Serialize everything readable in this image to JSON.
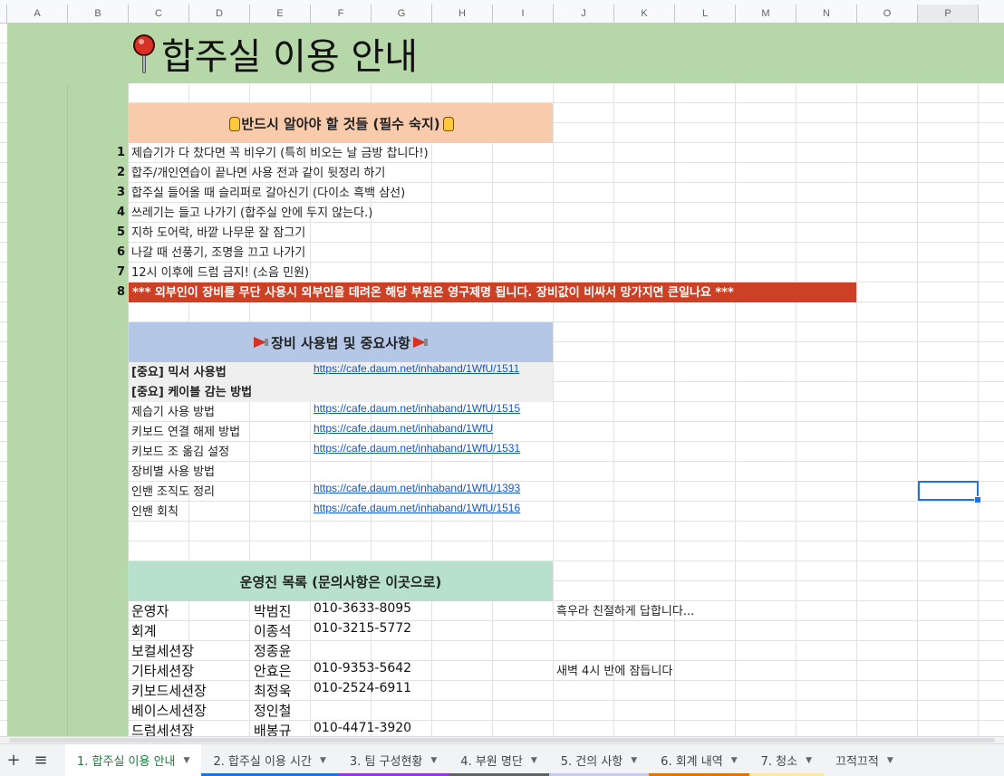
{
  "columns": [
    "A",
    "B",
    "C",
    "D",
    "E",
    "F",
    "G",
    "H",
    "I",
    "J",
    "K",
    "L",
    "M",
    "N",
    "O",
    "P"
  ],
  "selected_column": "P",
  "title": "합주실 이용 안내",
  "section1": {
    "header": "반드시 알아야 할 것들 (필수 숙지)"
  },
  "rules": [
    {
      "num": "1",
      "text": "제습기가 다 찼다면 꼭 비우기 (특히 비오는 날 금방 찹니다!)"
    },
    {
      "num": "2",
      "text": "합주/개인연습이 끝나면 사용 전과 같이 뒷정리 하기"
    },
    {
      "num": "3",
      "text": "합주실 들어올 때 슬리퍼로 갈아신기 (다이소 흑백 삼선)"
    },
    {
      "num": "4",
      "text": "쓰레기는 들고 나가기 (합주실 안에 두지 않는다.)"
    },
    {
      "num": "5",
      "text": "지하 도어락, 바깥 나무문 잘 잠그기"
    },
    {
      "num": "6",
      "text": "나갈 때 선풍기, 조명을 끄고 나가기"
    },
    {
      "num": "7",
      "text": "12시 이후에 드럼 금지! (소음 민원)"
    }
  ],
  "warning": {
    "num": "8",
    "text": "*** 외부인이 장비를 무단 사용시 외부인을 데려온 해당 부원은 영구제명 됩니다. 장비값이 비싸서 망가지면 큰일나요 ***"
  },
  "section2": {
    "header": "장비 사용법 및 중요사항"
  },
  "equipment": [
    {
      "label": "[중요] 믹서 사용법",
      "link": "https://cafe.daum.net/inhaband/1WfU/1511"
    },
    {
      "label": "[중요] 케이블 감는 방법",
      "link": ""
    },
    {
      "label": "제습기 사용 방법",
      "link": "https://cafe.daum.net/inhaband/1WfU/1515"
    },
    {
      "label": "키보드 연결 해제 방법",
      "link": "https://cafe.daum.net/inhaband/1WfU"
    },
    {
      "label": "키보드 조 옮김 설정",
      "link": "https://cafe.daum.net/inhaband/1WfU/1531"
    },
    {
      "label": "장비별 사용 방법",
      "link": ""
    },
    {
      "label": "인밴 조직도 정리",
      "link": "https://cafe.daum.net/inhaband/1WfU/1393"
    },
    {
      "label": "인밴 회칙",
      "link": "https://cafe.daum.net/inhaband/1WfU/1516"
    }
  ],
  "section3": {
    "header": "운영진 목록 (문의사항은 이곳으로)"
  },
  "staff": [
    {
      "role": "운영자",
      "name": "박범진",
      "phone": "010-3633-8095",
      "note": "흑우라 친절하게 답합니다..."
    },
    {
      "role": "회계",
      "name": "이종석",
      "phone": "010-3215-5772",
      "note": ""
    },
    {
      "role": "보컬세션장",
      "name": "정종윤",
      "phone": "",
      "note": ""
    },
    {
      "role": "기타세션장",
      "name": "안효은",
      "phone": "010-9353-5642",
      "note": "새벽 4시 반에 잠듭니다"
    },
    {
      "role": "키보드세션장",
      "name": "최정욱",
      "phone": "010-2524-6911",
      "note": ""
    },
    {
      "role": "베이스세션장",
      "name": "정인철",
      "phone": "",
      "note": ""
    },
    {
      "role": "드럼세션장",
      "name": "배봉규",
      "phone": "010-4471-3920",
      "note": ""
    }
  ],
  "sheet_tabs": [
    {
      "label": "1. 합주실 이용 안내",
      "active": true,
      "color": ""
    },
    {
      "label": "2. 합주실 이용 시간",
      "active": false,
      "color": "#1a73e8"
    },
    {
      "label": "3. 팀 구성현황",
      "active": false,
      "color": "#9334e6"
    },
    {
      "label": "4. 부원 명단",
      "active": false,
      "color": "#5f6368"
    },
    {
      "label": "5. 건의 사항",
      "active": false,
      "color": "#c5cae9"
    },
    {
      "label": "6. 회계 내역",
      "active": false,
      "color": "#e37400"
    },
    {
      "label": "7. 청소",
      "active": false,
      "color": "#fbe9a0"
    },
    {
      "label": "끄적끄적",
      "active": false,
      "color": ""
    }
  ],
  "icons": {
    "title": "round-pushpin-icon",
    "section1": "backhand-index-pointing-right-icon",
    "section2": "loudspeaker-icon",
    "add_sheet": "plus-icon",
    "all_sheets": "hamburger-menu-icon"
  },
  "colors": {
    "title_bg": "#b6d7a8",
    "section1_bg": "#f8cbad",
    "section2_bg": "#b4c7e7",
    "section3_bg": "#b7e1cd",
    "warning_bg": "#cc4125",
    "link": "#1155cc",
    "active_tab_text": "#188038"
  }
}
